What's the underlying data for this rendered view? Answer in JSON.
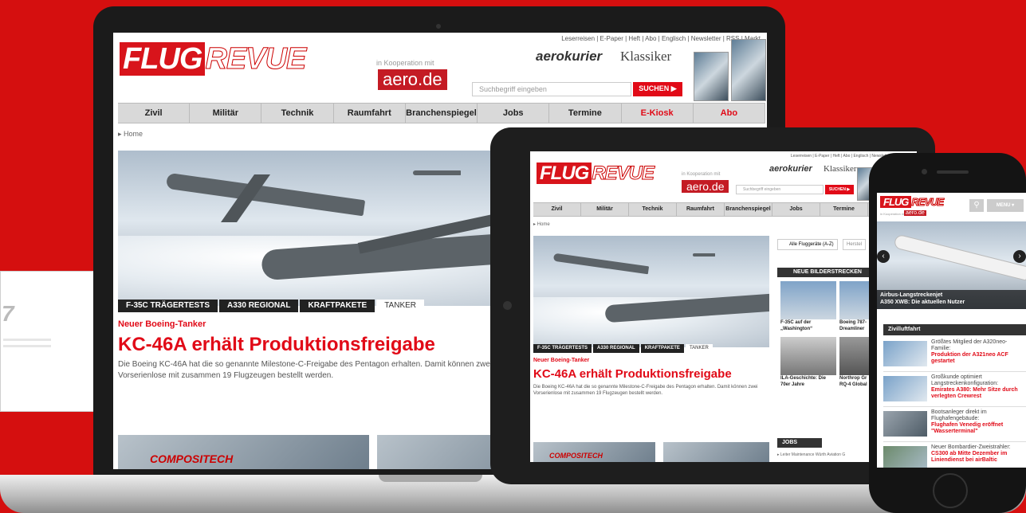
{
  "site": {
    "util_links": "Leserreisen | E-Paper | Heft | Abo | Englisch | Newsletter | RSS | Markt",
    "brand_part1": "FLUG",
    "brand_part2": "REVUE",
    "koop": "in Kooperation mit",
    "aero": "aero.de",
    "aerokurier": "aerokurier",
    "klassiker": "Klassiker",
    "search_placeholder": "Suchbegriff eingeben",
    "search_button": "SUCHEN ▶",
    "nav": [
      {
        "label": "Zivil"
      },
      {
        "label": "Militär"
      },
      {
        "label": "Technik"
      },
      {
        "label": "Raumfahrt"
      },
      {
        "label": "Branchenspiegel"
      },
      {
        "label": "Jobs"
      },
      {
        "label": "Termine"
      },
      {
        "label": "E-Kiosk",
        "accent": true
      },
      {
        "label": "Abo",
        "accent": true
      }
    ],
    "breadcrumb": "▸ Home",
    "tabs": [
      "F-35C TRÄGERTESTS",
      "A330 REGIONAL",
      "KRAFTPAKETE",
      "TANKER"
    ],
    "kicker": "Neuer Boeing-Tanker",
    "headline": "KC-46A erhält Produktionsfreigabe",
    "teaser": "Die Boeing KC-46A hat die so genannte Milestone-C-Freigabe des Pentagon erhalten. Damit können zwei Vorserienlose mit zusammen 19 Flugzeugen bestellt werden.",
    "thumb_label": "COMPOSITECH",
    "colors": {
      "accent": "#e10a17",
      "background": "#d50f0f"
    }
  },
  "tablet": {
    "aircraft_btn": "Alle Fluggeräte (A-Z)",
    "aircraft_btn2": "Herstel",
    "bilderstrecken": "NEUE BILDERSTRECKEN",
    "gallery": [
      "F-35C auf der „Washington“",
      "Boeing 787-Dreamliner",
      "ILA-Geschichte: Die 70er Jahre",
      "Northrop Gr RQ-4 Global"
    ],
    "jobs_header": "JOBS",
    "job1": "▸ Leiter Maintenance Würth Aviation G"
  },
  "phone": {
    "menu": "MENU ▾",
    "slide_title": "Airbus-Langstreckenjet",
    "slide_sub": "A350 XWB: Die aktuellen Nutzer",
    "section": "Zivilluftfahrt",
    "items": [
      {
        "text": "Größtes Mitglied der A320neo-Familie:",
        "red": "Produktion der A321neo ACF gestartet"
      },
      {
        "text": "Großkunde optimiert Langstreckenkonfiguration:",
        "red": "Emirates A380: Mehr Sitze durch verlegten Crewrest"
      },
      {
        "text": "Bootsanleger direkt im Flughafengebäude:",
        "red": "Flughafen Venedig eröffnet \"Wasserterminal\""
      },
      {
        "text": "Neuer Bombardier-Zweistrahler:",
        "red": "CS300 ab Mitte Dezember im Liniendienst bei airBaltic"
      }
    ]
  }
}
